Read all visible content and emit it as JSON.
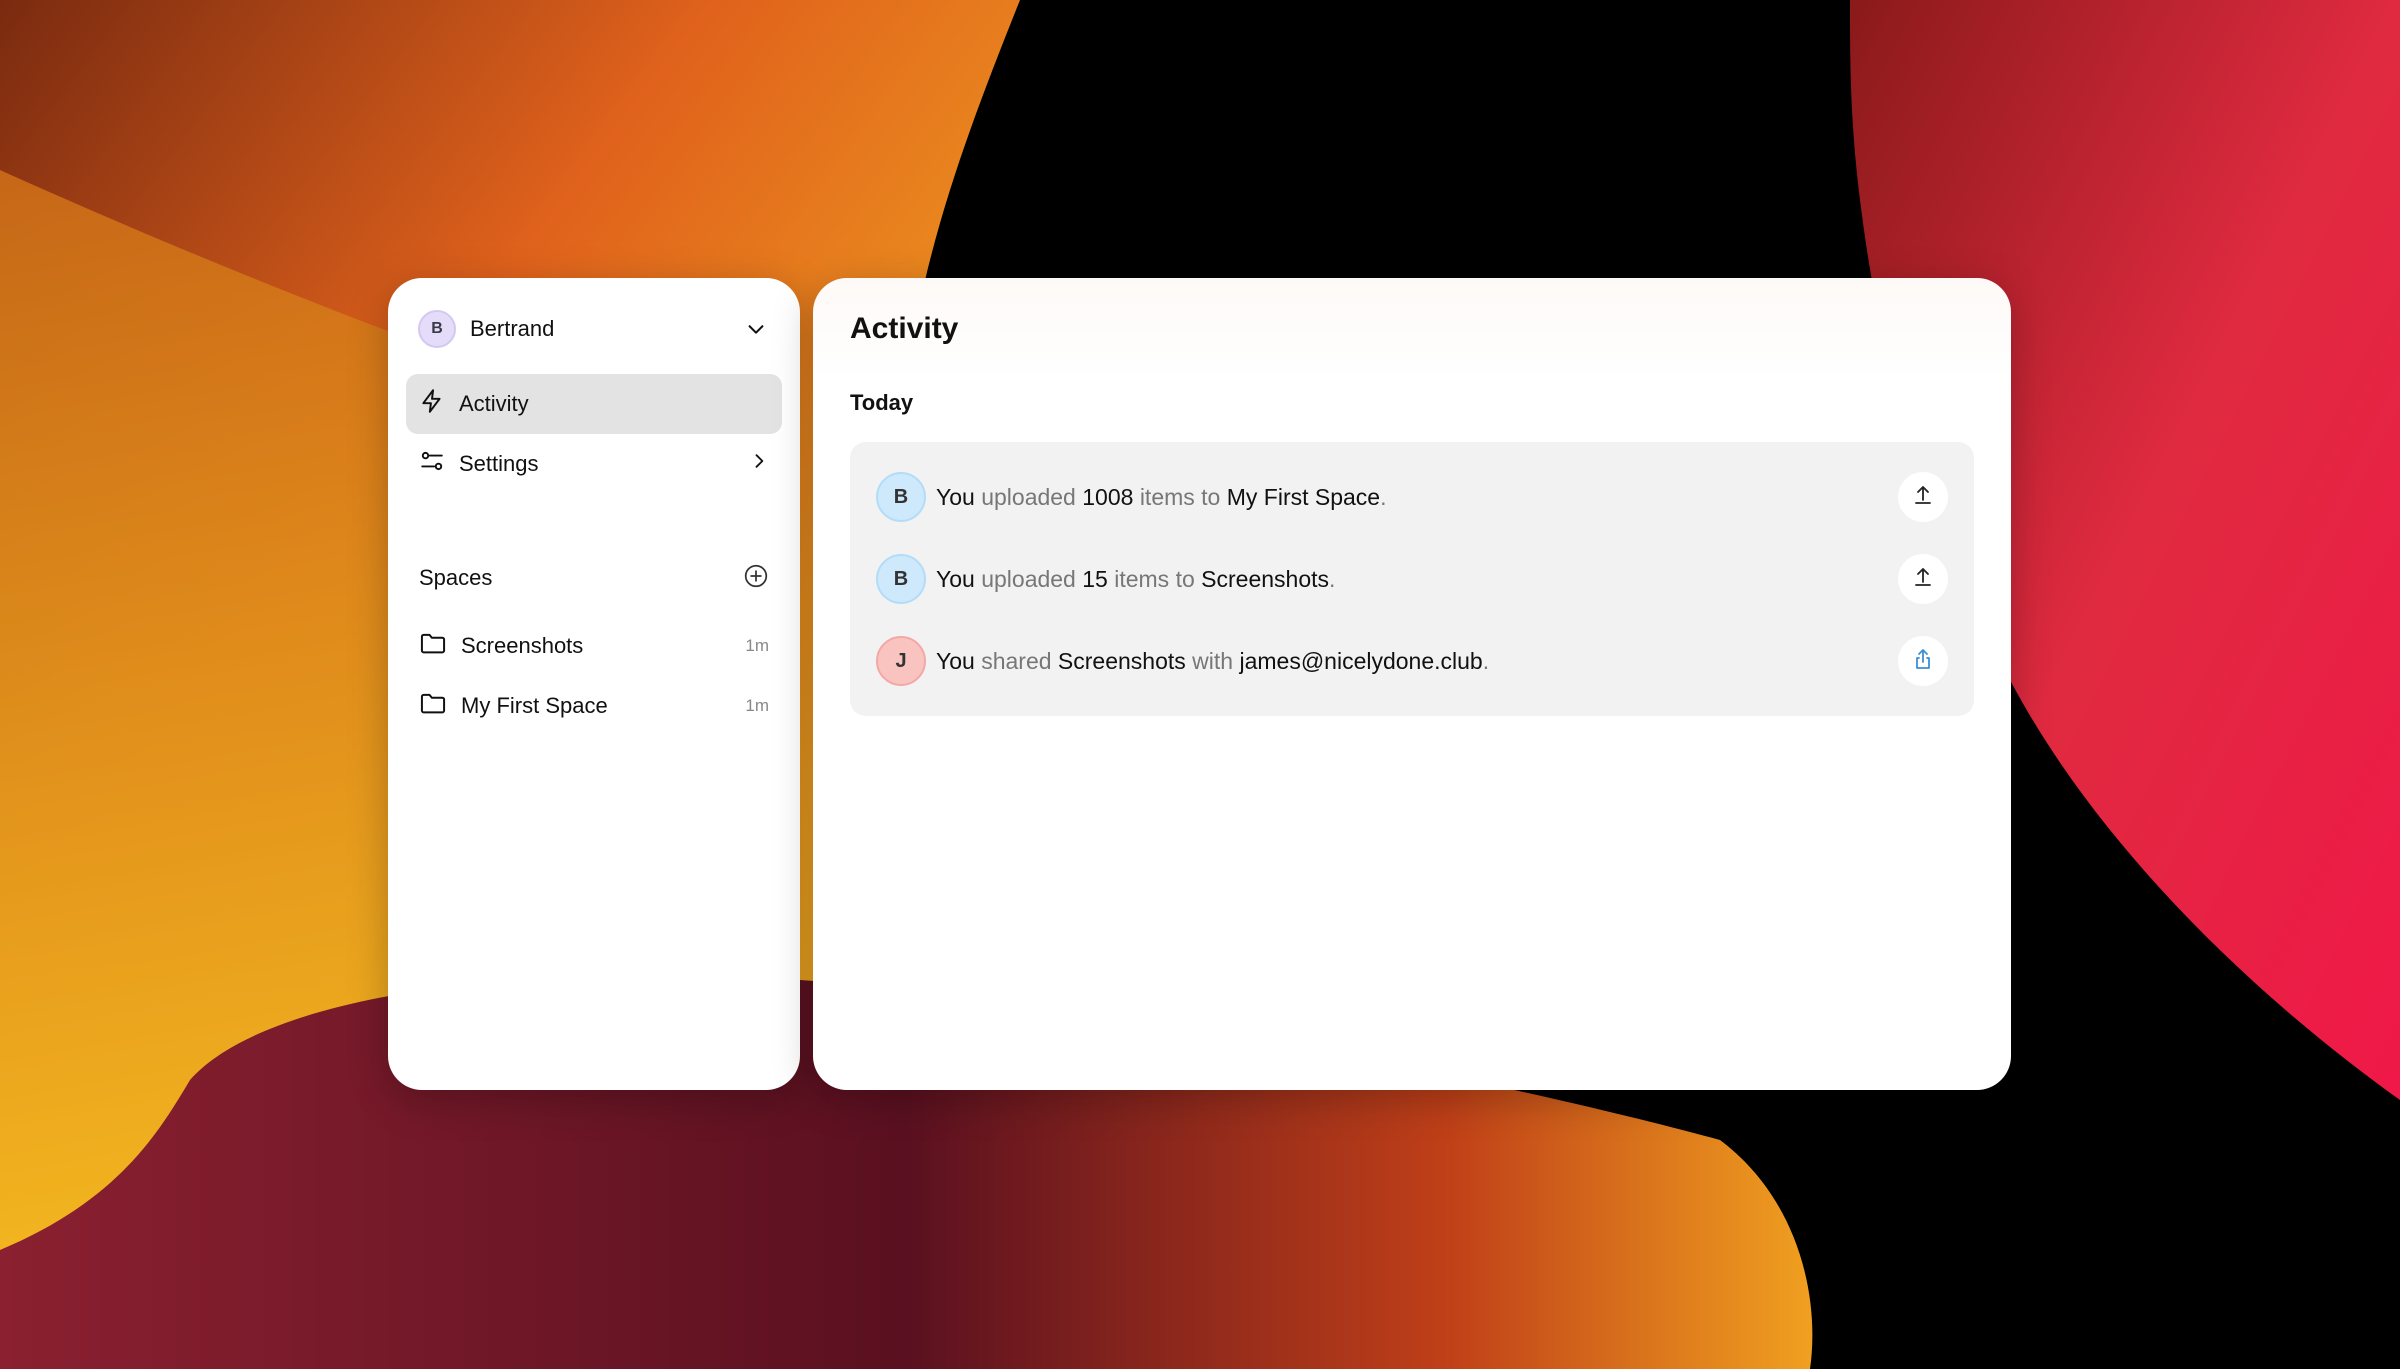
{
  "user": {
    "initial": "B",
    "name": "Bertrand"
  },
  "nav": [
    {
      "label": "Activity",
      "icon": "lightning-icon",
      "active": true
    },
    {
      "label": "Settings",
      "icon": "sliders-icon",
      "active": false
    }
  ],
  "spaces": {
    "title": "Spaces",
    "items": [
      {
        "name": "Screenshots",
        "time": "1m"
      },
      {
        "name": "My First Space",
        "time": "1m"
      }
    ]
  },
  "main": {
    "title": "Activity",
    "day": "Today",
    "activities": [
      {
        "avatar": "B",
        "actor": "You",
        "verb": "uploaded",
        "count": "1008",
        "mid": "items to",
        "target": "My First Space",
        "end": ".",
        "icon": "upload-icon"
      },
      {
        "avatar": "B",
        "actor": "You",
        "verb": "uploaded",
        "count": "15",
        "mid": "items to",
        "target": "Screenshots",
        "end": ".",
        "icon": "upload-icon"
      },
      {
        "avatar": "J",
        "actor": "You",
        "verb": "shared",
        "count": "Screenshots",
        "mid": "with",
        "target": "james@nicelydone.club",
        "end": ".",
        "icon": "share-icon"
      }
    ]
  },
  "colors": {
    "accent_blue": "#3b8fd6",
    "active_nav": "#e3e3e3",
    "activity_bg": "#f2f2f2"
  }
}
